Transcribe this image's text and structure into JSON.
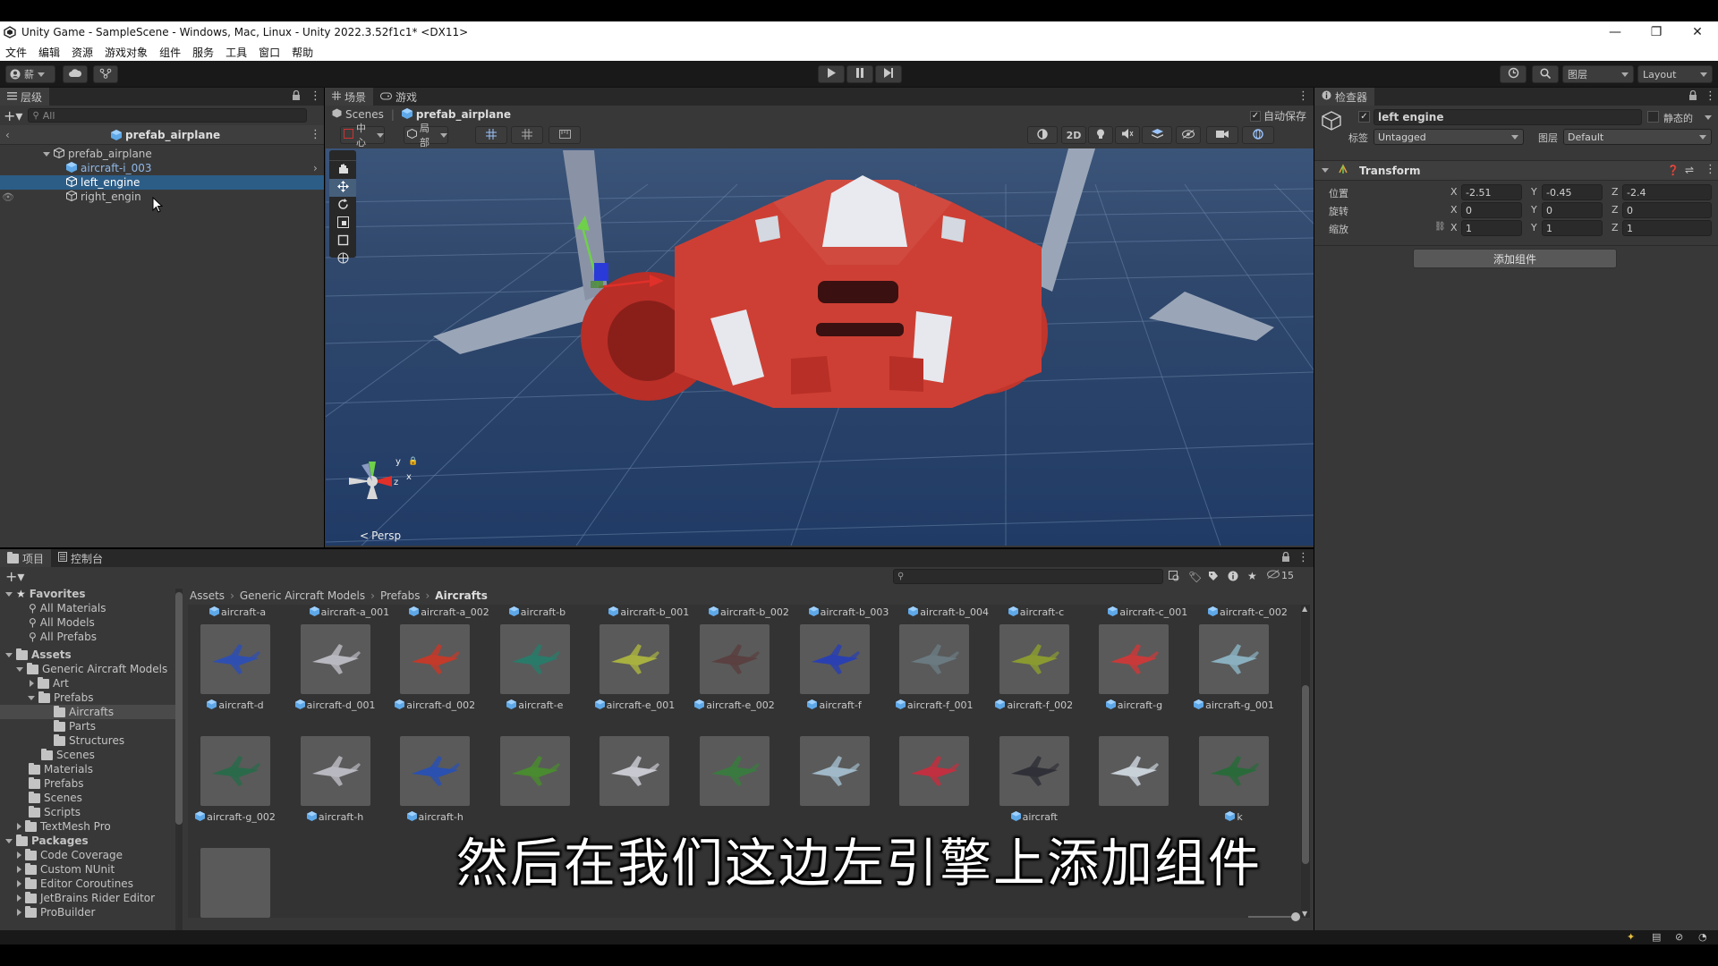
{
  "window": {
    "title": "Unity Game - SampleScene - Windows, Mac, Linux - Unity 2022.3.52f1c1* <DX11>",
    "controls": [
      "—",
      "❐",
      "✕"
    ]
  },
  "menu": [
    "文件",
    "编辑",
    "资源",
    "游戏对象",
    "组件",
    "服务",
    "工具",
    "窗口",
    "帮助"
  ],
  "toolbar": {
    "account": "薪",
    "layers": "图层",
    "layout": "Layout"
  },
  "hierarchy": {
    "tab": "层级",
    "search_placeholder": "All",
    "header": "prefab_airplane",
    "items": [
      {
        "label": "prefab_airplane"
      },
      {
        "label": "aircraft-i_003"
      },
      {
        "label": "left_engine"
      },
      {
        "label": "right_engin"
      }
    ]
  },
  "scene": {
    "tabs": [
      "场景",
      "游戏"
    ],
    "breadcrumb": [
      "Scenes",
      "prefab_airplane"
    ],
    "autosave": "自动保存",
    "pivot": "中心",
    "space": "局部",
    "mode2d": "2D",
    "persp": "Persp",
    "gizmo_y": "y",
    "gizmo_z": "z",
    "gizmo_x": "x"
  },
  "inspector": {
    "tab": "检查器",
    "object_name": "left engine",
    "static": "静态的",
    "tag_label": "标签",
    "tag_value": "Untagged",
    "layer_label": "图层",
    "layer_value": "Default",
    "component": "Transform",
    "rows": [
      {
        "label": "位置",
        "x": "-2.51",
        "y": "-0.45",
        "z": "-2.4"
      },
      {
        "label": "旋转",
        "x": "0",
        "y": "0",
        "z": "0"
      },
      {
        "label": "缩放",
        "x": "1",
        "y": "1",
        "z": "1"
      }
    ],
    "add_component": "添加组件"
  },
  "project": {
    "tabs": [
      "项目",
      "控制台"
    ],
    "hidden_count": "15",
    "breadcrumb": [
      "Assets",
      "Generic Aircraft Models",
      "Prefabs",
      "Aircrafts"
    ],
    "tree": [
      {
        "label": "Favorites"
      },
      {
        "label": "All Materials"
      },
      {
        "label": "All Models"
      },
      {
        "label": "All Prefabs"
      },
      {
        "label": "Assets"
      },
      {
        "label": "Generic Aircraft Models"
      },
      {
        "label": "Art"
      },
      {
        "label": "Prefabs"
      },
      {
        "label": "Aircrafts"
      },
      {
        "label": "Parts"
      },
      {
        "label": "Structures"
      },
      {
        "label": "Scenes"
      },
      {
        "label": "Materials"
      },
      {
        "label": "Prefabs"
      },
      {
        "label": "Scenes"
      },
      {
        "label": "Scripts"
      },
      {
        "label": "TextMesh Pro"
      },
      {
        "label": "Packages"
      },
      {
        "label": "Code Coverage"
      },
      {
        "label": "Custom NUnit"
      },
      {
        "label": "Editor Coroutines"
      },
      {
        "label": "JetBrains Rider Editor"
      },
      {
        "label": "ProBuilder"
      }
    ],
    "top_row": [
      "aircraft-a",
      "aircraft-a_001",
      "aircraft-a_002",
      "aircraft-b",
      "aircraft-b_001",
      "aircraft-b_002",
      "aircraft-b_003",
      "aircraft-b_004",
      "aircraft-c",
      "aircraft-c_001",
      "aircraft-c_002"
    ],
    "row1": [
      "aircraft-d",
      "aircraft-d_001",
      "aircraft-d_002",
      "aircraft-e",
      "aircraft-e_001",
      "aircraft-e_002",
      "aircraft-f",
      "aircraft-f_001",
      "aircraft-f_002",
      "aircraft-g",
      "aircraft-g_001"
    ],
    "row2": [
      "aircraft-g_002",
      "aircraft-h",
      "aircraft-h",
      "",
      "",
      "",
      "",
      "",
      "aircraft",
      "",
      "k"
    ],
    "row1_colors": [
      "#2f4fb0",
      "#b8b8c0",
      "#c23a2a",
      "#2a7a6a",
      "#a8b040",
      "#5a4040",
      "#2a40b0",
      "#6a7a80",
      "#8a9a30",
      "#c83a3a",
      "#8ab0c0"
    ],
    "row2_colors": [
      "#2a6a4a",
      "#b8b8c0",
      "#2a50b0",
      "#4a8a30",
      "#c8c8d0",
      "#3a7a40",
      "#a0b8c8",
      "#c03040",
      "#303038",
      "#c8d0d8",
      "#2a6a3a"
    ]
  },
  "subtitle": "然后在我们这边左引擎上添加组件"
}
